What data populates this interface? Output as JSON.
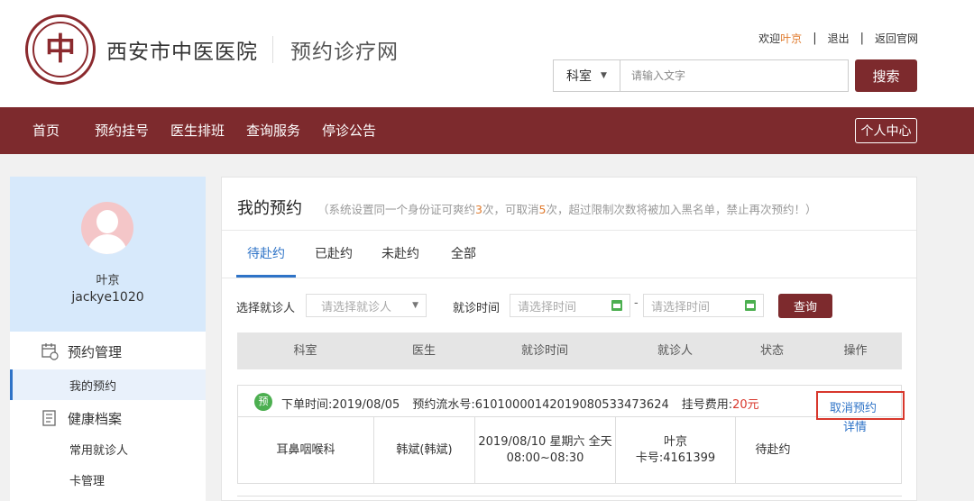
{
  "header": {
    "site_title": "西安市中医医院",
    "site_subtitle": "预约诊疗网",
    "logo_glyph": "中",
    "welcome": "欢迎",
    "user_name": "叶京",
    "logout": "退出",
    "back_home": "返回官网",
    "search": {
      "dept_label": "科室",
      "placeholder": "请输入文字",
      "button": "搜索"
    }
  },
  "nav": {
    "items": [
      "首页",
      "预约挂号",
      "医生排班",
      "查询服务",
      "停诊公告"
    ],
    "personal_center": "个人中心"
  },
  "sidebar": {
    "profile_name": "叶京",
    "profile_id": "jackye1020",
    "sections": [
      {
        "label": "预约管理",
        "icon": "calendar-icon",
        "items": [
          "我的预约"
        ]
      },
      {
        "label": "健康档案",
        "icon": "file-list-icon",
        "items": [
          "常用就诊人",
          "卡管理"
        ]
      }
    ],
    "active_item": "我的预约"
  },
  "main": {
    "title": "我的预约",
    "note_parts": [
      "（系统设置同一个身份证可爽约",
      "3",
      "次，可取消",
      "5",
      "次，超过限制次数将被加入黑名单，禁止再次预约！）"
    ],
    "tabs": [
      "待赴约",
      "已赴约",
      "未赴约",
      "全部"
    ],
    "active_tab": "待赴约",
    "filters": {
      "patient_label": "选择就诊人",
      "patient_placeholder": "请选择就诊人",
      "time_label": "就诊时间",
      "start_placeholder": "请选择时间",
      "end_placeholder": "请选择时间",
      "dash": "-",
      "query_button": "查询"
    },
    "table_headers": [
      "科室",
      "医生",
      "就诊时间",
      "就诊人",
      "状态",
      "操作"
    ],
    "order": {
      "badge": "预",
      "order_time": "下单时间:2019/08/05",
      "serial": "预约流水号:61010000142019080533473624",
      "fee_label": "挂号费用:",
      "fee_value": "20元",
      "dept": "耳鼻咽喉科",
      "doctor": "韩斌(韩斌)",
      "visit_date": "2019/08/10 星期六 全天",
      "visit_time": "08:00~08:30",
      "patient_name": "叶京",
      "card_no": "卡号:4161399",
      "status": "待赴约",
      "op_cancel": "取消预约",
      "op_detail": "详情"
    }
  }
}
